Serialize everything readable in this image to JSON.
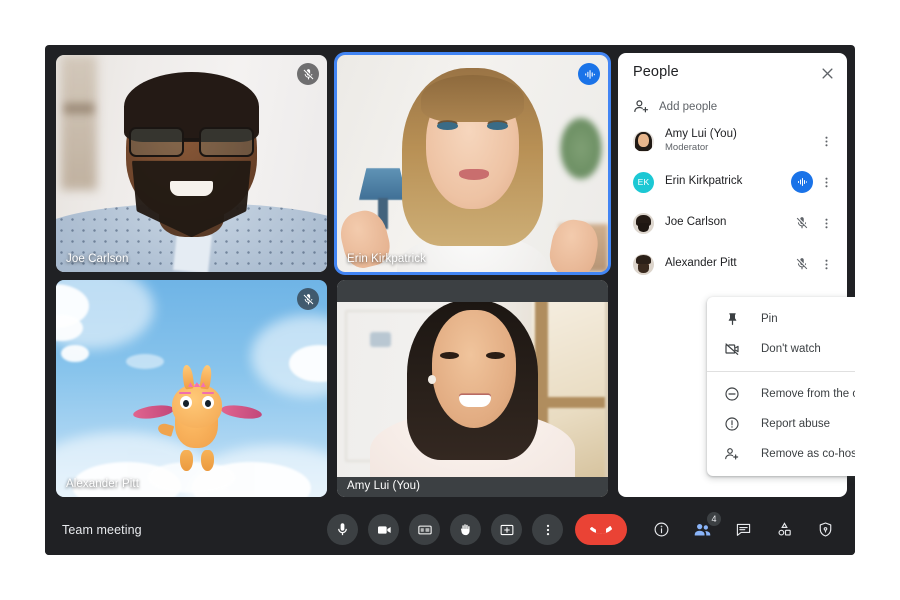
{
  "app": {
    "meeting_name": "Team meeting",
    "accent_blue": "#1a73e8",
    "active_speaker_border": "#4285f4",
    "end_call_red": "#ea4335",
    "surface_dark": "#202124",
    "control_dark": "#3c4043"
  },
  "video_grid": {
    "tiles": [
      {
        "name": "Joe Carlson",
        "status_icon": "mic-off-icon",
        "status_state": "muted",
        "active_speaker": false,
        "kind": "camera"
      },
      {
        "name": "Erin Kirkpatrick",
        "status_icon": "audio-active-icon",
        "status_state": "speaking",
        "active_speaker": true,
        "kind": "camera"
      },
      {
        "name": "Alexander Pitt",
        "status_icon": "mic-off-icon",
        "status_state": "muted",
        "active_speaker": false,
        "kind": "animated-avatar"
      },
      {
        "name": "Amy Lui (You)",
        "status_icon": "",
        "status_state": "none",
        "active_speaker": false,
        "kind": "camera-letterboxed"
      }
    ]
  },
  "people_panel": {
    "title": "People",
    "close_icon": "close-icon",
    "add_people": {
      "label": "Add people",
      "icon": "person-add-icon"
    },
    "people": [
      {
        "name": "Amy Lui (You)",
        "role": "Moderator",
        "avatar_type": "photo",
        "avatar_initials": "",
        "avatar_color": "",
        "status_icon": "",
        "status_state": "none",
        "menu_icon": "more-vert-icon"
      },
      {
        "name": "Erin Kirkpatrick",
        "role": "",
        "avatar_type": "initials",
        "avatar_initials": "EK",
        "avatar_color": "#1cc8d4",
        "status_icon": "audio-active-icon",
        "status_state": "speaking",
        "menu_icon": "more-vert-icon"
      },
      {
        "name": "Joe Carlson",
        "role": "",
        "avatar_type": "photo",
        "avatar_initials": "",
        "avatar_color": "",
        "status_icon": "mic-off-icon",
        "status_state": "muted",
        "menu_icon": "more-vert-icon"
      },
      {
        "name": "Alexander Pitt",
        "role": "",
        "avatar_type": "photo",
        "avatar_initials": "",
        "avatar_color": "",
        "status_icon": "mic-off-icon",
        "status_state": "muted",
        "menu_icon": "more-vert-icon"
      }
    ]
  },
  "context_menu": {
    "groups": [
      {
        "items": [
          {
            "label": "Pin",
            "icon": "pin-icon"
          },
          {
            "label": "Don't watch",
            "icon": "video-off-icon"
          }
        ]
      },
      {
        "items": [
          {
            "label": "Remove from the call",
            "icon": "remove-circle-icon"
          },
          {
            "label": "Report abuse",
            "icon": "report-icon"
          },
          {
            "label": "Remove as co-host",
            "icon": "person-remove-icon"
          }
        ]
      }
    ]
  },
  "bottom_bar": {
    "center_controls": [
      {
        "name": "microphone-button",
        "icon": "mic-icon"
      },
      {
        "name": "camera-button",
        "icon": "video-icon"
      },
      {
        "name": "captions-button",
        "icon": "closed-caption-icon"
      },
      {
        "name": "raise-hand-button",
        "icon": "hand-icon"
      },
      {
        "name": "present-screen-button",
        "icon": "present-icon"
      },
      {
        "name": "more-options-button",
        "icon": "more-vert-icon"
      }
    ],
    "end_call": {
      "name": "end-call-button",
      "icon": "call-end-icon"
    },
    "right_controls": [
      {
        "name": "meeting-details-button",
        "icon": "info-icon",
        "active": false,
        "badge": ""
      },
      {
        "name": "people-button",
        "icon": "people-icon",
        "active": true,
        "badge": "4"
      },
      {
        "name": "chat-button",
        "icon": "chat-icon",
        "active": false,
        "badge": ""
      },
      {
        "name": "activities-button",
        "icon": "activities-icon",
        "active": false,
        "badge": ""
      },
      {
        "name": "host-controls-button",
        "icon": "shield-icon",
        "active": false,
        "badge": ""
      }
    ]
  }
}
